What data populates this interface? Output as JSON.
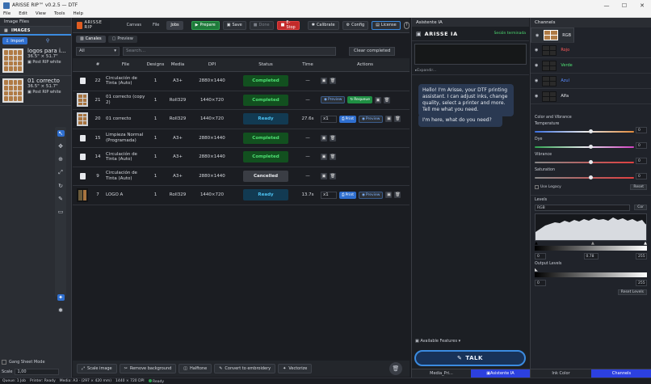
{
  "window": {
    "title": "ARISSE RIP™ v0.2.5 — DTF"
  },
  "menu": [
    "File",
    "Edit",
    "View",
    "Tools",
    "Help"
  ],
  "left": {
    "header": "Image Files",
    "tab": "IMAGES",
    "import_label": "Import",
    "items": [
      {
        "name": "logos para i...",
        "size": "36.5\" × 51.7\"",
        "status": "Post RIP white"
      },
      {
        "name": "01 correcto",
        "size": "36.5\" × 51.7\"",
        "status": "Post RIP white"
      }
    ],
    "gang_label": "Gang Sheet Mode",
    "scale_label": "Scale",
    "scale_value": "1,00"
  },
  "topbar": {
    "brand": "ARISSE RIP",
    "tabs": [
      "Canvas",
      "File",
      "Jobs"
    ],
    "active_tab": "Jobs",
    "prepare": "Prepare",
    "save": "Save",
    "done": "Done",
    "estop": "E-Stop",
    "calibrate": "Calibrate",
    "config": "Config",
    "license": "License"
  },
  "subtabs": {
    "canales": "Canales",
    "preview": "Preview"
  },
  "filter": {
    "selected": "All",
    "search_placeholder": "Search...",
    "clear": "Clear completed"
  },
  "jobs": {
    "headers": [
      "#",
      "File",
      "Designs",
      "Media",
      "DPI",
      "Status",
      "Time",
      "Actions"
    ],
    "rows": [
      {
        "id": "22",
        "file": "Circulación de Tinta (Auto)",
        "designs": "1",
        "media": "A3+",
        "dpi": "2880×1440",
        "status": "Completed",
        "time": "—",
        "thumb": "doc"
      },
      {
        "id": "21",
        "file": "01 correcto (copy 2)",
        "designs": "1",
        "media": "Roll329",
        "dpi": "1440×720",
        "status": "Completed",
        "time": "—",
        "thumb": "img",
        "preview": "Preview",
        "requeue": "Requeue"
      },
      {
        "id": "20",
        "file": "01 correcto",
        "designs": "1",
        "media": "Roll329",
        "dpi": "1440×720",
        "status": "Ready",
        "time": "27.6s",
        "thumb": "img",
        "qty": "x1",
        "print": "Print",
        "preview": "Preview"
      },
      {
        "id": "15",
        "file": "Limpieza Normal (Programada)",
        "designs": "1",
        "media": "A3+",
        "dpi": "2880×1440",
        "status": "Completed",
        "time": "—",
        "thumb": "doc"
      },
      {
        "id": "14",
        "file": "Circulación de Tinta (Auto)",
        "designs": "1",
        "media": "A3+",
        "dpi": "2880×1440",
        "status": "Completed",
        "time": "—",
        "thumb": "doc"
      },
      {
        "id": "9",
        "file": "Circulación de Tinta (Auto)",
        "designs": "1",
        "media": "A3+",
        "dpi": "2880×1440",
        "status": "Cancelled",
        "time": "—",
        "thumb": "doc"
      },
      {
        "id": "7",
        "file": "LOGO A",
        "designs": "1",
        "media": "Roll329",
        "dpi": "1440×720",
        "status": "Ready",
        "time": "13.7s",
        "thumb": "dark",
        "qty": "x1",
        "print": "Print",
        "preview": "Preview"
      }
    ]
  },
  "bottombar": [
    "Scale image",
    "Remove background",
    "Halftone",
    "Convert to embroidery",
    "Vectorize"
  ],
  "statusbar": {
    "queue": "Queue: 1 Job",
    "printer": "Printer: Ready",
    "media": "Media: A3 · (297 × 420 mm)",
    "dpi": "1440 × 720 DPI",
    "ready": "Ready"
  },
  "assistant": {
    "header": "Asistente IA",
    "brand": "ARISSE IA",
    "session": "Sesión terminada",
    "expand": "Expandir...",
    "msg1": "Hello! I'm Arisse, your DTF printing assistant. I can adjust inks, change quality, select a printer and more. Tell me what you need.",
    "msg2": "I'm here, what do you need?",
    "features": "Available Features",
    "talk": "TALK",
    "tabs": [
      "Media_Pri...",
      "Asistente IA"
    ],
    "active_tab": "Asistente IA"
  },
  "channels": {
    "header": "Channels",
    "items": [
      {
        "label": "RGB",
        "color": "#e6e8ec"
      },
      {
        "label": "Rojo",
        "color": "#ff5a5a"
      },
      {
        "label": "Verde",
        "color": "#4ee073"
      },
      {
        "label": "Azul",
        "color": "#5a8cff"
      },
      {
        "label": "Alfa",
        "color": "#e6e8ec"
      }
    ],
    "color_vibrance": "Color and Vibrance",
    "temperature": "Temperature",
    "temperature_value": "0",
    "dye": "Dye",
    "dye_value": "0",
    "vibrance": "Vibrance",
    "vibrance_value": "0",
    "saturation": "Saturation",
    "saturation_value": "0",
    "legacy": "Use Legacy",
    "reset": "Reset",
    "levels": "Levels",
    "levels_channel": "RGB",
    "cor": "Cor",
    "in_black": "0",
    "in_gamma": "0.78",
    "in_white": "255",
    "output_levels": "Output Levels",
    "out_black": "0",
    "out_white": "255",
    "reset_levels": "Reset Levels",
    "tabs": [
      "Ink Color",
      "Channels"
    ],
    "active_tab": "Channels"
  }
}
